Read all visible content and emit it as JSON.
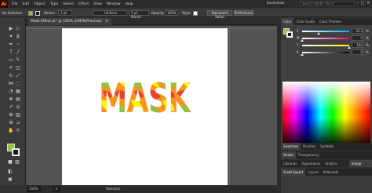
{
  "app": {
    "logo": "Ai",
    "workspace": "Essentials",
    "search_placeholder": "Search Adobe Stock"
  },
  "menu": [
    "File",
    "Edit",
    "Object",
    "Type",
    "Select",
    "Effect",
    "View",
    "Window",
    "Help"
  ],
  "window_controls": [
    "–",
    "□",
    "✕"
  ],
  "controlbar": {
    "selection": "No Selection",
    "stroke_label": "Stroke:",
    "stroke_weight": "1 pt",
    "profile": "Uniform",
    "brush": "5 pt. Round",
    "opacity_label": "Opacity:",
    "opacity_value": "100%",
    "style_label": "Style:",
    "document_setup": "Document Setup",
    "preferences": "Preferences"
  },
  "document": {
    "tab": "Mask Effect.ai* @ 150% (CMYK/Preview)",
    "close": "✕"
  },
  "statusbar": {
    "zoom": "150%",
    "page": "1",
    "tool": "Selection"
  },
  "color_panel": {
    "tabs": [
      "Color",
      "Color Guide",
      "Color Themes"
    ],
    "sliders": [
      {
        "label": "C",
        "value": "35.2",
        "fraction": 0.35,
        "color_from": "#ffffff",
        "color_to": "#00aeef"
      },
      {
        "label": "M",
        "value": "0",
        "fraction": 0.0,
        "color_from": "#ffffff",
        "color_to": "#ec008c"
      },
      {
        "label": "Y",
        "value": "100",
        "fraction": 1.0,
        "color_from": "#ffffff",
        "color_to": "#fff200"
      },
      {
        "label": "K",
        "value": "0",
        "fraction": 0.0,
        "color_from": "#ffffff",
        "color_to": "#000000"
      }
    ],
    "pct": "%"
  },
  "swatches_tabs": [
    "Swatches",
    "Brushes",
    "Symbols"
  ],
  "stroke_tabs": [
    "Stroke",
    "Transparency"
  ],
  "libraries_tabs": [
    "Libraries",
    "Appearance",
    "Graphic Styles",
    "Image Trace"
  ],
  "asset_tabs": [
    "Asset Export",
    "Layers",
    "Artboards"
  ],
  "artwork_text": "MASK",
  "colors": {
    "fill": "#8cc63f",
    "mask_red": "#e8432d",
    "mask_orange": "#f7941d",
    "mask_yellow": "#fff200",
    "mask_green": "#8cc63f"
  }
}
